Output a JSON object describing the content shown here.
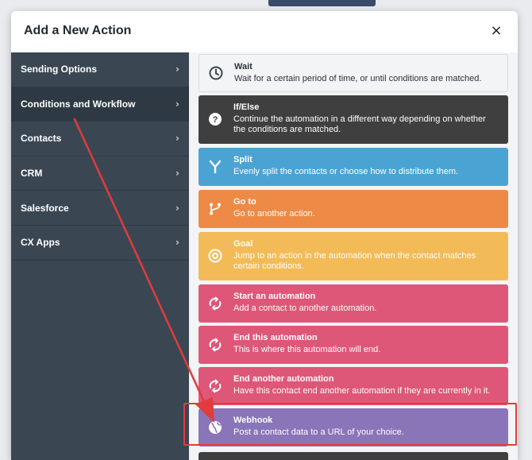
{
  "modal": {
    "title": "Add a New Action",
    "close_label": "×"
  },
  "sidebar": {
    "items": [
      {
        "label": "Sending Options",
        "active": false
      },
      {
        "label": "Conditions and Workflow",
        "active": true
      },
      {
        "label": "Contacts",
        "active": false
      },
      {
        "label": "CRM",
        "active": false
      },
      {
        "label": "Salesforce",
        "active": false
      },
      {
        "label": "CX Apps",
        "active": false
      }
    ],
    "chevron": "›"
  },
  "actions": [
    {
      "title": "Wait",
      "desc": "Wait for a certain period of time, or until conditions are matched.",
      "icon": "clock-icon",
      "color": "#ffffff"
    },
    {
      "title": "If/Else",
      "desc": "Continue the automation in a different way depending on whether the conditions are matched.",
      "icon": "question-icon",
      "color": "#3f3f3f"
    },
    {
      "title": "Split",
      "desc": "Evenly split the contacts or choose how to distribute them.",
      "icon": "split-icon",
      "color": "#4ba3d4"
    },
    {
      "title": "Go to",
      "desc": "Go to another action.",
      "icon": "branch-icon",
      "color": "#ee8a46"
    },
    {
      "title": "Goal",
      "desc": "Jump to an action in the automation when the contact matches certain conditions.",
      "icon": "target-icon",
      "color": "#f3bb57"
    },
    {
      "title": "Start an automation",
      "desc": "Add a contact to another automation.",
      "icon": "cycle-icon",
      "color": "#de5778"
    },
    {
      "title": "End this automation",
      "desc": "This is where this automation will end.",
      "icon": "cycle-icon",
      "color": "#de5778"
    },
    {
      "title": "End another automation",
      "desc": "Have this contact end another automation if they are currently in it.",
      "icon": "cycle-icon",
      "color": "#de5778"
    },
    {
      "title": "Webhook",
      "desc": "Post a contact data to a URL of your choice.",
      "icon": "globe-icon",
      "color": "#8a75b8"
    }
  ],
  "annotation_color": "#e23b3b"
}
